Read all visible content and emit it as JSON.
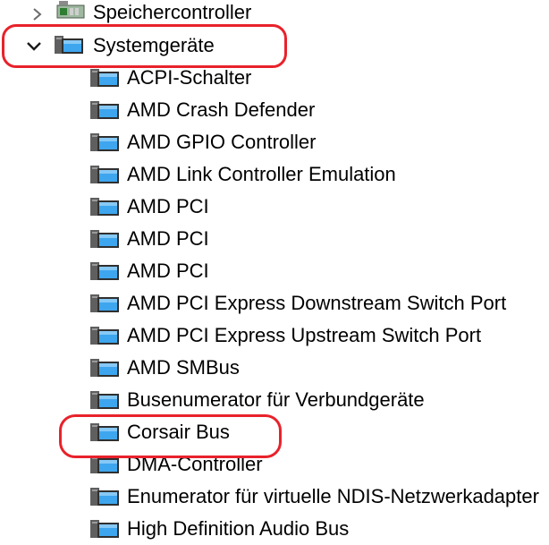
{
  "tree": {
    "nodes": [
      {
        "label": "Speichercontroller",
        "expander": "chevron-right-icon",
        "icon": "storage-controller-icon",
        "level": 0
      },
      {
        "label": "Systemgeräte",
        "expander": "chevron-down-icon",
        "icon": "system-device-folder-icon",
        "level": 0
      },
      {
        "label": "ACPI-Schalter",
        "icon": "system-device-icon",
        "level": 1
      },
      {
        "label": "AMD Crash Defender",
        "icon": "system-device-icon",
        "level": 1
      },
      {
        "label": "AMD GPIO Controller",
        "icon": "system-device-icon",
        "level": 1
      },
      {
        "label": "AMD Link Controller Emulation",
        "icon": "system-device-icon",
        "level": 1
      },
      {
        "label": "AMD PCI",
        "icon": "system-device-icon",
        "level": 1
      },
      {
        "label": "AMD PCI",
        "icon": "system-device-icon",
        "level": 1
      },
      {
        "label": "AMD PCI",
        "icon": "system-device-icon",
        "level": 1
      },
      {
        "label": "AMD PCI Express Downstream Switch Port",
        "icon": "system-device-icon",
        "level": 1
      },
      {
        "label": "AMD PCI Express Upstream Switch Port",
        "icon": "system-device-icon",
        "level": 1
      },
      {
        "label": "AMD SMBus",
        "icon": "system-device-icon",
        "level": 1
      },
      {
        "label": "Busenumerator für Verbundgeräte",
        "icon": "system-device-icon",
        "level": 1
      },
      {
        "label": "Corsair Bus",
        "icon": "system-device-icon",
        "level": 1
      },
      {
        "label": "DMA-Controller",
        "icon": "system-device-icon",
        "level": 1
      },
      {
        "label": "Enumerator für virtuelle NDIS-Netzwerkadapter",
        "icon": "system-device-icon",
        "level": 1
      },
      {
        "label": "High Definition Audio Bus",
        "icon": "system-device-icon",
        "level": 1
      }
    ]
  },
  "annotations": {
    "highlight_color": "#e8222b",
    "highlighted_items": [
      "Systemgeräte",
      "Corsair Bus"
    ]
  }
}
